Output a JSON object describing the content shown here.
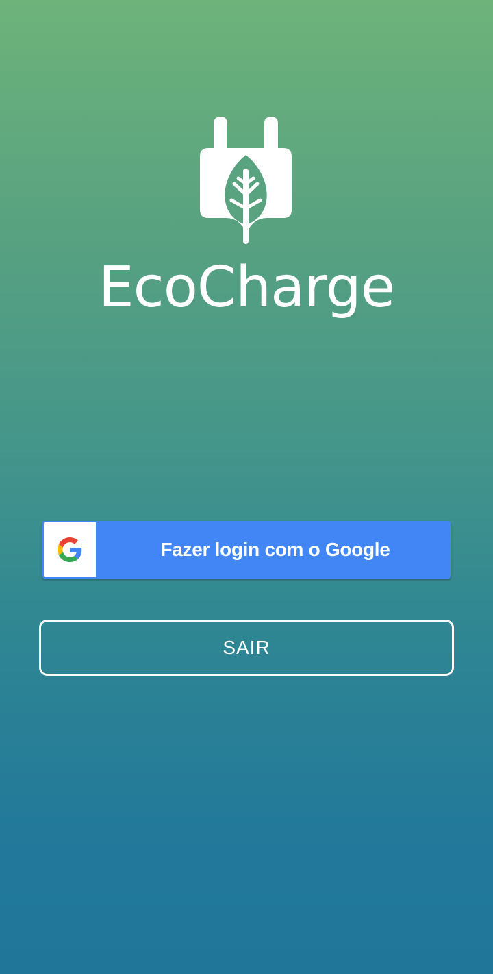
{
  "app": {
    "title": "EcoCharge",
    "logo_icon": "plug-leaf-icon"
  },
  "login": {
    "google_button_label": "Fazer login com o Google",
    "google_icon": "google-g-icon",
    "exit_button_label": "SAIR"
  },
  "colors": {
    "gradient_top": "#6db37a",
    "gradient_bottom": "#1f7699",
    "google_blue": "#4285f4",
    "text": "#ffffff"
  }
}
